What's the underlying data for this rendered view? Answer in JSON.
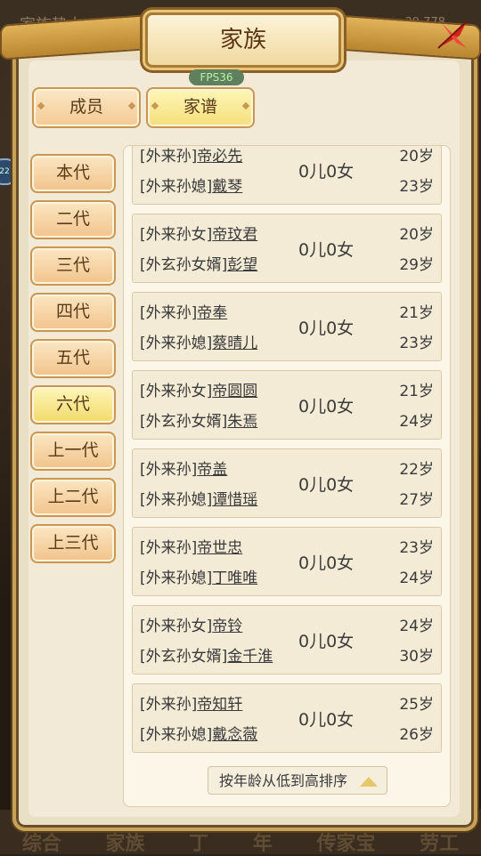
{
  "background": {
    "top_title": "家族势力",
    "top_values": "39  778",
    "bottom_tabs": [
      "综合",
      "家族",
      "丁",
      "年",
      "传家宝",
      "劳工"
    ],
    "side_badge": "22"
  },
  "dialog": {
    "title": "家族",
    "fps": "FPS36",
    "tabs": [
      {
        "label": "成员",
        "active": false
      },
      {
        "label": "家谱",
        "active": true
      }
    ],
    "generations": [
      {
        "label": "本代",
        "active": false
      },
      {
        "label": "二代",
        "active": false
      },
      {
        "label": "三代",
        "active": false
      },
      {
        "label": "四代",
        "active": false
      },
      {
        "label": "五代",
        "active": false
      },
      {
        "label": "六代",
        "active": true
      },
      {
        "label": "上一代",
        "active": false
      },
      {
        "label": "上二代",
        "active": false
      },
      {
        "label": "上三代",
        "active": false
      }
    ],
    "couples": [
      {
        "p1_role": "[外来孙]",
        "p1_name": "帝必先",
        "p1_age": "20岁",
        "p2_role": "[外来孙媳]",
        "p2_name": "戴琴",
        "p2_age": "23岁",
        "children": "0儿0女"
      },
      {
        "p1_role": "[外来孙女]",
        "p1_name": "帝玟君",
        "p1_age": "20岁",
        "p2_role": "[外玄孙女婿]",
        "p2_name": "彭望",
        "p2_age": "29岁",
        "children": "0儿0女"
      },
      {
        "p1_role": "[外来孙]",
        "p1_name": "帝奉",
        "p1_age": "21岁",
        "p2_role": "[外来孙媳]",
        "p2_name": "蔡晴儿",
        "p2_age": "23岁",
        "children": "0儿0女"
      },
      {
        "p1_role": "[外来孙女]",
        "p1_name": "帝圆圆",
        "p1_age": "21岁",
        "p2_role": "[外玄孙女婿]",
        "p2_name": "朱焉",
        "p2_age": "24岁",
        "children": "0儿0女"
      },
      {
        "p1_role": "[外来孙]",
        "p1_name": "帝盖",
        "p1_age": "22岁",
        "p2_role": "[外来孙媳]",
        "p2_name": "谭惜瑶",
        "p2_age": "27岁",
        "children": "0儿0女"
      },
      {
        "p1_role": "[外来孙]",
        "p1_name": "帝世忠",
        "p1_age": "23岁",
        "p2_role": "[外来孙媳]",
        "p2_name": "丁唯唯",
        "p2_age": "24岁",
        "children": "0儿0女"
      },
      {
        "p1_role": "[外来孙女]",
        "p1_name": "帝铃",
        "p1_age": "24岁",
        "p2_role": "[外玄孙女婿]",
        "p2_name": "金千淮",
        "p2_age": "30岁",
        "children": "0儿0女"
      },
      {
        "p1_role": "[外来孙]",
        "p1_name": "帝知轩",
        "p1_age": "25岁",
        "p2_role": "[外来孙媳]",
        "p2_name": "戴念薇",
        "p2_age": "26岁",
        "children": "0儿0女"
      }
    ],
    "sort_label": "按年龄从低到高排序",
    "colors": {
      "accent_gold": "#c99654",
      "active_tab": "#f3df7a",
      "close_red": "#d8231d"
    }
  }
}
